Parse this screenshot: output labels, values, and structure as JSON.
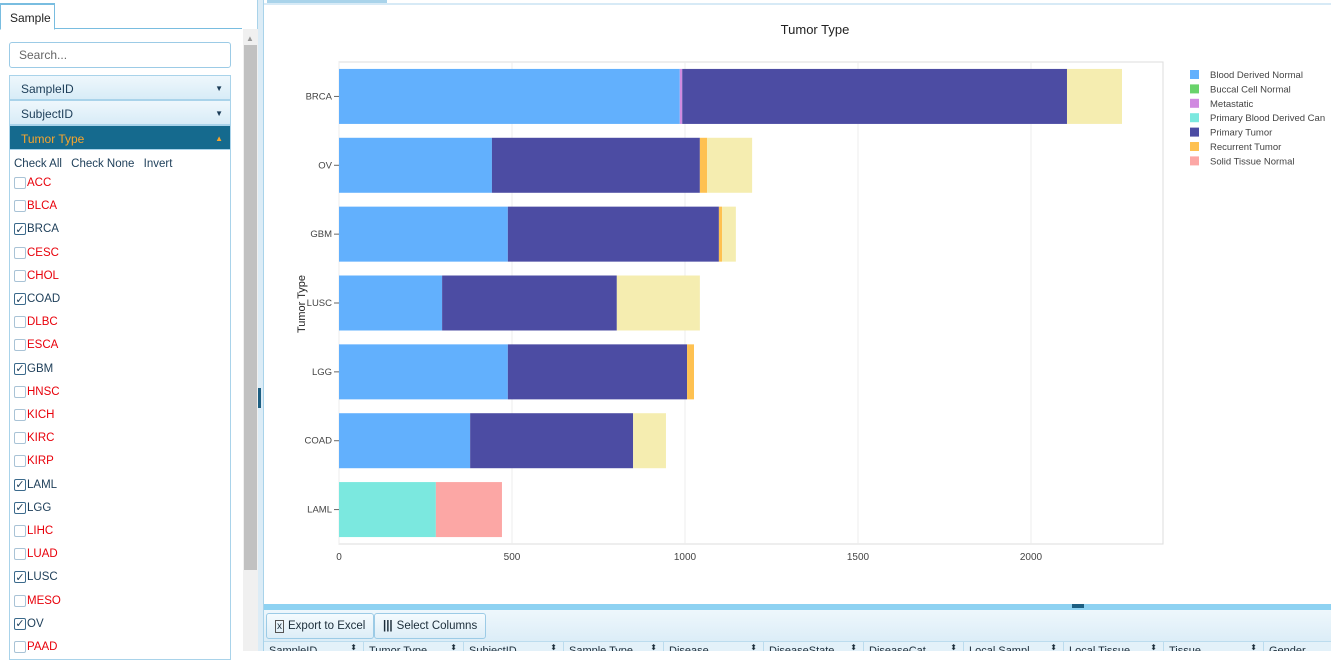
{
  "left_panel": {
    "tab": "Sample",
    "search_placeholder": "Search...",
    "accordion": [
      {
        "label": "SampleID",
        "expanded": false
      },
      {
        "label": "SubjectID",
        "expanded": false
      },
      {
        "label": "Tumor Type",
        "expanded": true
      }
    ],
    "check_all": "Check All",
    "check_none": "Check None",
    "invert": "Invert",
    "items": [
      {
        "label": "ACC",
        "checked": false
      },
      {
        "label": "BLCA",
        "checked": false
      },
      {
        "label": "BRCA",
        "checked": true
      },
      {
        "label": "CESC",
        "checked": false
      },
      {
        "label": "CHOL",
        "checked": false
      },
      {
        "label": "COAD",
        "checked": true
      },
      {
        "label": "DLBC",
        "checked": false
      },
      {
        "label": "ESCA",
        "checked": false
      },
      {
        "label": "GBM",
        "checked": true
      },
      {
        "label": "HNSC",
        "checked": false
      },
      {
        "label": "KICH",
        "checked": false
      },
      {
        "label": "KIRC",
        "checked": false
      },
      {
        "label": "KIRP",
        "checked": false
      },
      {
        "label": "LAML",
        "checked": true
      },
      {
        "label": "LGG",
        "checked": true
      },
      {
        "label": "LIHC",
        "checked": false
      },
      {
        "label": "LUAD",
        "checked": false
      },
      {
        "label": "LUSC",
        "checked": true
      },
      {
        "label": "MESO",
        "checked": false
      },
      {
        "label": "OV",
        "checked": true
      },
      {
        "label": "PAAD",
        "checked": false
      }
    ]
  },
  "toolbar": {
    "export": "Export to Excel",
    "select_columns": "Select Columns"
  },
  "table_columns": [
    "SampleID",
    "Tumor Type",
    "SubjectID",
    "Sample Type",
    "Disease",
    "DiseaseState",
    "DiseaseCat",
    "Local Sampl...",
    "Local Tissue",
    "Tissue",
    "Gender"
  ],
  "chart_data": {
    "type": "bar",
    "orientation": "horizontal",
    "stacked": true,
    "title": "Tumor Type",
    "ylabel": "Tumor Type",
    "xlabel": "",
    "xlim": [
      0,
      2380
    ],
    "xticks": [
      0,
      500,
      1000,
      1500,
      2000
    ],
    "grid": true,
    "legend": "right",
    "categories": [
      "BRCA",
      "OV",
      "GBM",
      "LUSC",
      "LGG",
      "COAD",
      "LAML"
    ],
    "series": [
      {
        "name": "Blood Derived Normal",
        "color": "#62b0fd",
        "values": [
          985,
          442,
          488,
          298,
          488,
          379,
          0
        ]
      },
      {
        "name": "Buccal Cell Normal",
        "color": "#69d36b",
        "values": [
          0,
          0,
          0,
          0,
          0,
          0,
          0
        ]
      },
      {
        "name": "Metastatic",
        "color": "#d08ae0",
        "values": [
          7,
          0,
          0,
          0,
          0,
          0,
          0
        ]
      },
      {
        "name": "Primary Blood Derived Can",
        "color": "#7be8df",
        "values": [
          0,
          0,
          0,
          0,
          0,
          0,
          280
        ]
      },
      {
        "name": "Primary Tumor",
        "color": "#4c4ca3",
        "values": [
          1112,
          601,
          610,
          505,
          518,
          471,
          0
        ]
      },
      {
        "name": "Recurrent Tumor",
        "color": "#fec151",
        "values": [
          0,
          21,
          9,
          0,
          20,
          0,
          0
        ]
      },
      {
        "name": "Solid Tissue Normal",
        "color": "#fca7a5",
        "values": [
          0,
          0,
          0,
          0,
          0,
          0,
          191
        ]
      },
      {
        "color": "#f5edb0",
        "values": [
          159,
          130,
          40,
          240,
          0,
          95,
          0
        ]
      }
    ]
  }
}
